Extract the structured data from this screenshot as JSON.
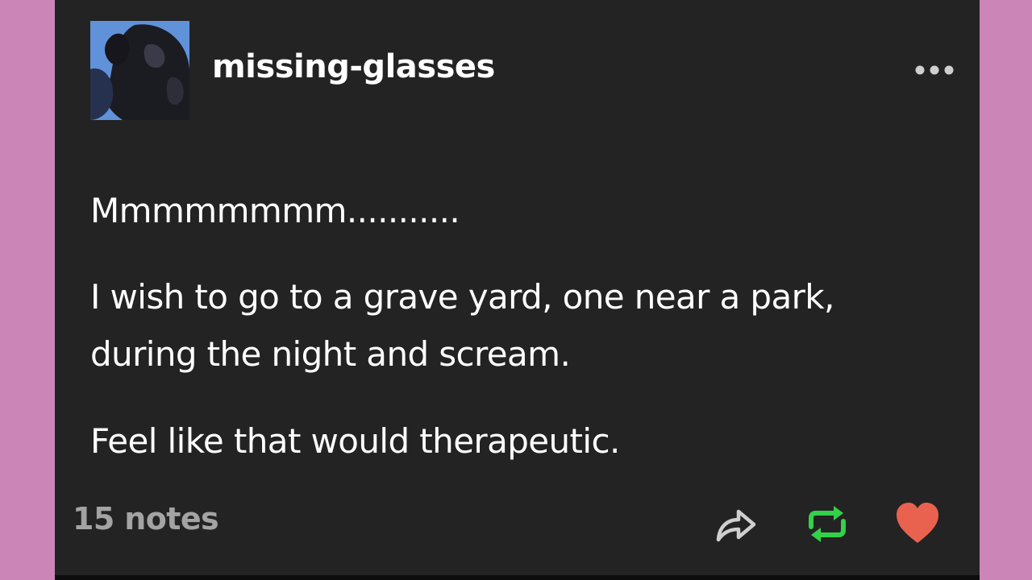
{
  "post": {
    "username": "missing-glasses",
    "paragraphs": [
      "Mmmmmmmm...........",
      "I wish to go to a grave yard, one near a park,",
      "during the night and scream.",
      "Feel like that would therapeutic."
    ],
    "notes_label": "15 notes"
  },
  "icons": {
    "more": "more-options-icon",
    "share": "share-icon",
    "reblog": "reblog-icon",
    "like": "heart-icon"
  },
  "colors": {
    "background": "#cc85b7",
    "card": "#232323",
    "text": "#ffffff",
    "notes": "#a3a3a3",
    "reblog": "#33d14a",
    "like": "#e8624f",
    "share": "#cfcfcf"
  }
}
